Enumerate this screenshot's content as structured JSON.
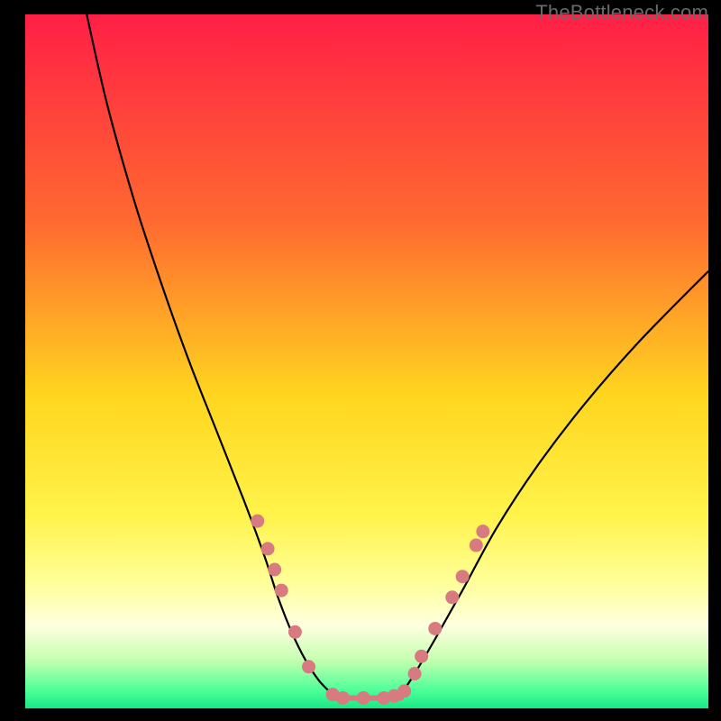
{
  "watermark": "TheBottleneck.com",
  "colors": {
    "black": "#000000",
    "curve": "#000000",
    "marker_fill": "#d87b80",
    "marker_stroke": "#b85a60"
  },
  "chart_data": {
    "type": "line",
    "title": "",
    "xlabel": "",
    "ylabel": "",
    "xlim": [
      0,
      100
    ],
    "ylim": [
      0,
      100
    ],
    "gradient_stops": [
      {
        "offset": 0.0,
        "color": "#ff1f46"
      },
      {
        "offset": 0.3,
        "color": "#ff6a30"
      },
      {
        "offset": 0.55,
        "color": "#ffd61f"
      },
      {
        "offset": 0.72,
        "color": "#fff34a"
      },
      {
        "offset": 0.82,
        "color": "#ffff9a"
      },
      {
        "offset": 0.88,
        "color": "#ffffe0"
      },
      {
        "offset": 0.93,
        "color": "#c6ffb0"
      },
      {
        "offset": 0.975,
        "color": "#4bff97"
      },
      {
        "offset": 1.0,
        "color": "#18e885"
      }
    ],
    "series": [
      {
        "name": "left-curve",
        "x": [
          9,
          12,
          16,
          20,
          24,
          28,
          32,
          35,
          37,
          39,
          41,
          43,
          45
        ],
        "y": [
          100,
          87,
          73,
          61,
          50,
          40,
          30,
          22,
          16,
          11,
          7,
          4,
          2
        ]
      },
      {
        "name": "right-curve",
        "x": [
          55,
          57,
          60,
          64,
          69,
          75,
          82,
          90,
          100
        ],
        "y": [
          2,
          5,
          10,
          17,
          26,
          35,
          44,
          53,
          63
        ]
      },
      {
        "name": "valley-floor",
        "x": [
          45,
          55
        ],
        "y": [
          1.5,
          1.5
        ]
      }
    ],
    "markers": {
      "name": "curve-markers",
      "points": [
        {
          "x": 34.0,
          "y": 27.0
        },
        {
          "x": 35.5,
          "y": 23.0
        },
        {
          "x": 36.5,
          "y": 20.0
        },
        {
          "x": 37.5,
          "y": 17.0
        },
        {
          "x": 39.5,
          "y": 11.0
        },
        {
          "x": 41.5,
          "y": 6.0
        },
        {
          "x": 45.0,
          "y": 2.0
        },
        {
          "x": 46.5,
          "y": 1.5
        },
        {
          "x": 49.5,
          "y": 1.5
        },
        {
          "x": 52.5,
          "y": 1.5
        },
        {
          "x": 54.0,
          "y": 1.8
        },
        {
          "x": 55.5,
          "y": 2.5
        },
        {
          "x": 57.0,
          "y": 5.0
        },
        {
          "x": 58.0,
          "y": 7.5
        },
        {
          "x": 60.0,
          "y": 11.5
        },
        {
          "x": 62.5,
          "y": 16.0
        },
        {
          "x": 64.0,
          "y": 19.0
        },
        {
          "x": 66.0,
          "y": 23.5
        },
        {
          "x": 67.0,
          "y": 25.5
        }
      ]
    }
  }
}
